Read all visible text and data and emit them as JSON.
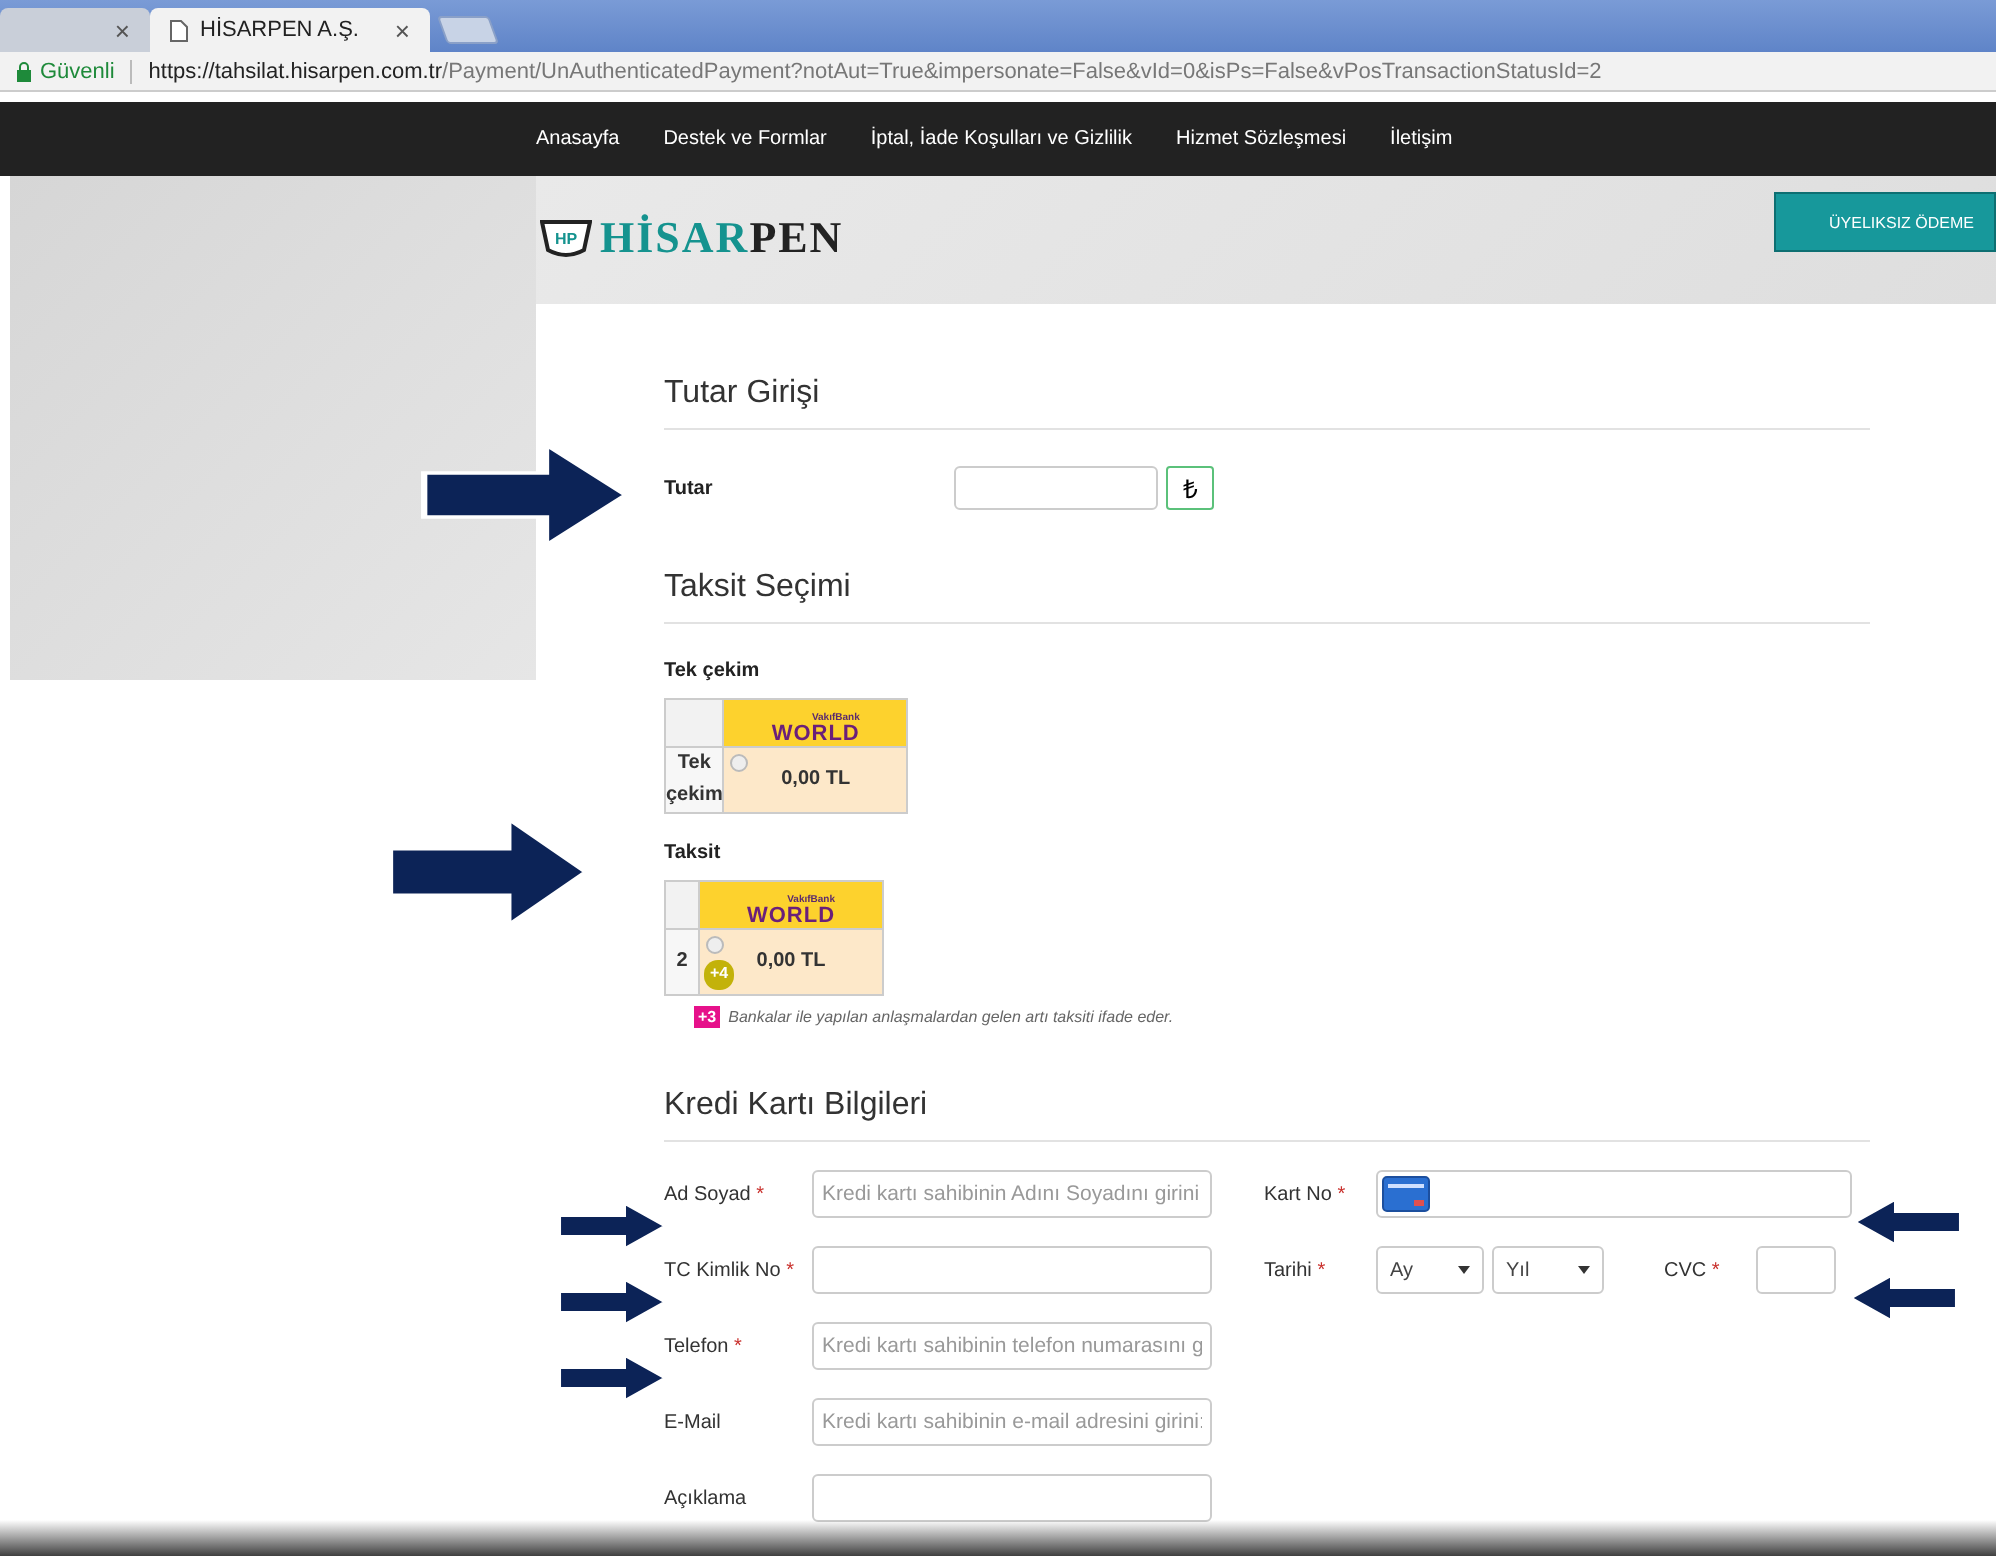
{
  "browser": {
    "tabs": [
      {
        "close": "×",
        "selected": false
      },
      {
        "title": "HİSARPEN A.Ş.",
        "close": "×",
        "selected": true
      }
    ],
    "security": "Güvenli",
    "url_host": "https://tahsilat.hisarpen.com.tr",
    "url_path": "/Payment/UnAuthenticatedPayment?notAut=True&impersonate=False&vId=0&isPs=False&vPosTransactionStatusId=2"
  },
  "nav": [
    "Anasayfa",
    "Destek ve Formlar",
    "İptal, İade Koşulları ve Gizlilik",
    "Hizmet Sözleşmesi",
    "İletişim"
  ],
  "logo": {
    "emblem": "HP",
    "primary": "HİSAR",
    "secondary": "PEN"
  },
  "guest_button": "ÜYELIKSIZ ÖDEME",
  "amount": {
    "heading": "Tutar Girişi",
    "label": "Tutar",
    "currency": "₺"
  },
  "installments": {
    "heading": "Taksit Seçimi",
    "groups": [
      {
        "title": "Tek çekim",
        "bank_small": "VakıfBank",
        "bank": "WORLD",
        "row": "Tek çekim",
        "amount": "0,00 TL",
        "selected": false
      },
      {
        "title": "Taksit",
        "bank_small": "VakıfBank",
        "bank": "WORLD",
        "row": "2",
        "amount": "0,00 TL",
        "selected": false,
        "bonus": "+4"
      }
    ],
    "note_badge": "+3",
    "note": "Bankalar ile yapılan anlaşmalardan gelen artı taksiti ifade eder."
  },
  "card": {
    "heading": "Kredi Kartı Bilgileri",
    "left_fields": [
      {
        "label": "Ad Soyad",
        "required_mark": "*",
        "placeholder": "Kredi kartı sahibinin Adını Soyadını girini"
      },
      {
        "label": "TC Kimlik No",
        "required_mark": "*"
      },
      {
        "label": "Telefon",
        "required_mark": "*",
        "placeholder": "Kredi kartı sahibinin telefon numarasını g"
      },
      {
        "label": "E-Mail",
        "placeholder": "Kredi kartı sahibinin e-mail adresini girini:"
      },
      {
        "label": "Açıklama"
      }
    ],
    "card_no": {
      "label": "Kart No",
      "required_mark": "*"
    },
    "expiry": {
      "label": "Tarihi",
      "required_mark": "*",
      "month": "Ay",
      "year": "Yıl"
    },
    "cvc": {
      "label": "CVC",
      "required_mark": "*"
    }
  }
}
